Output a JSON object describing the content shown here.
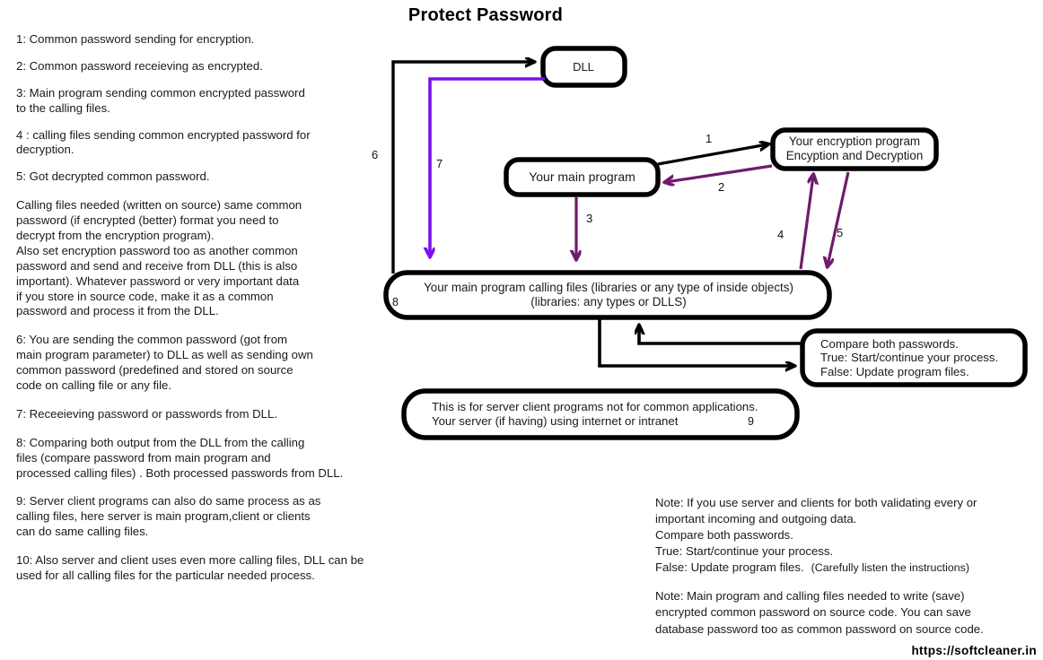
{
  "title": "Protect Password",
  "colors": {
    "stroke_black": "#000000",
    "violet": "#7B0FF0",
    "purple": "#6E1B6E",
    "text": "#1a1a1a"
  },
  "legend": {
    "items": [
      "1: Common password sending for encryption.",
      "2: Common password receieving as encrypted.",
      "3: Main program sending common encrypted password\nto the calling files.",
      "4 : calling files sending common encrypted password for\n decryption.",
      "5:  Got decrypted common password.",
      "Calling files needed (written on source) same common\npassword (if encrypted (better) format you need to\ndecrypt from the encryption program).\nAlso set encryption password too as another common\npassword and send and receive from DLL (this is also\nimportant). Whatever password or very important data\nif you store in source code, make it as a common\npassword and process it from the DLL.",
      "6: You are sending the common password (got from\nmain program parameter) to DLL as well as sending own\ncommon password (predefined and stored on source\ncode on calling file or any file.",
      "7: Receeieving password or passwords from DLL.",
      "8: Comparing both output from the DLL from the calling\nfiles (compare password from main program and\nprocessed calling files)  . Both processed passwords from DLL.",
      " 9: Server client programs can also do same process as as\n calling files, here  server is main program,client or clients\ncan do same calling files.",
      "10: Also server and client uses even more calling files, DLL can be\nused for all calling files for the particular needed process."
    ]
  },
  "diagram": {
    "nodes": {
      "dll": "DLL",
      "main_program": "Your main program",
      "encryption_program": "Your encryption program\nEncyption and Decryption",
      "calling_files": "Your main program calling files (libraries or any type of inside objects)\n(libraries: any types or DLLS)",
      "compare": "Compare both passwords.\nTrue: Start/continue your process.\nFalse: Update program files.",
      "server_client": "This is for server client programs not for common applications.\nYour server (if having) using internet or intranet"
    },
    "arrow_labels": {
      "a1": "1",
      "a2": "2",
      "a3": "3",
      "a4": "4",
      "a5": "5",
      "a6": "6",
      "a7": "7",
      "a8": "8",
      "a9": "9"
    }
  },
  "notes": {
    "note1": "Note: If you use server and clients for both validating every or\nimportant incoming and outgoing data.\nCompare both passwords.\nTrue: Start/continue your process.\nFalse: Update program files.",
    "note1_tail": "(Carefully listen the instructions)",
    "note2": "Note: Main program and calling files needed to write (save)\n        encrypted common password on source code. You can save\n        database password too as common password on source code."
  },
  "site_url": "https://softcleaner.in"
}
